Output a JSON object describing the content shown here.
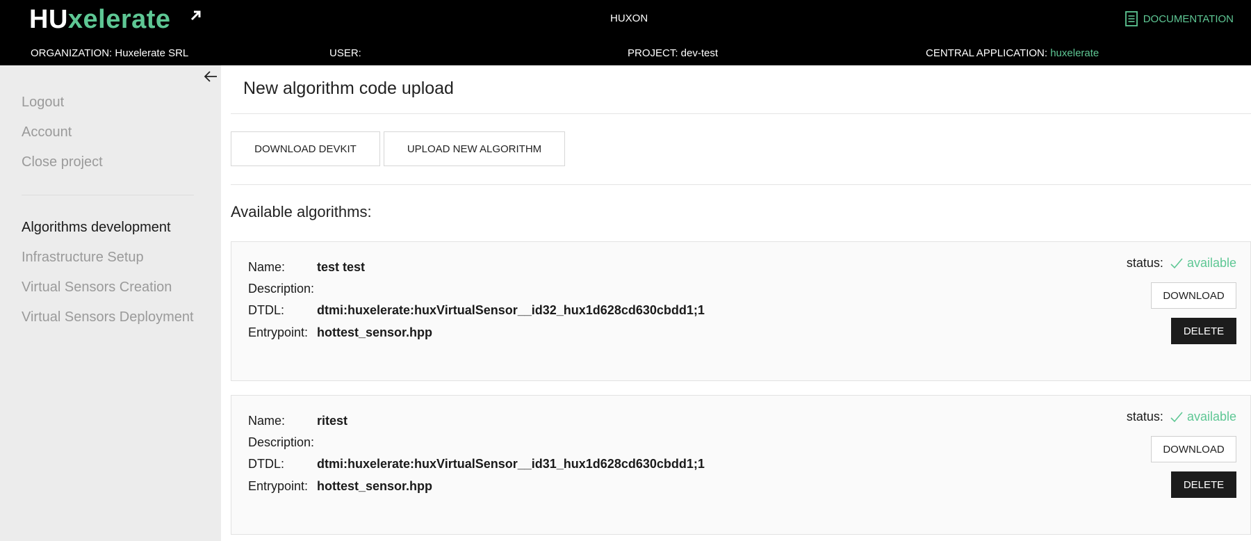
{
  "header": {
    "logo": {
      "part1": "HU",
      "part2": "xelerate"
    },
    "app_name": "HUXON",
    "documentation_label": "DOCUMENTATION",
    "organization": "ORGANIZATION: Huxelerate SRL",
    "user": "USER:",
    "project": "PROJECT: dev-test",
    "central_app_label": "CENTRAL APPLICATION:",
    "central_app_value": "huxelerate"
  },
  "sidebar": {
    "account_items": [
      "Logout",
      "Account",
      "Close project"
    ],
    "nav_items": [
      "Algorithms development",
      "Infrastructure Setup",
      "Virtual Sensors Creation",
      "Virtual Sensors Deployment"
    ],
    "active_item": "Algorithms development"
  },
  "main": {
    "title": "New algorithm code upload",
    "download_devkit_label": "DOWNLOAD DEVKIT",
    "upload_label": "UPLOAD NEW ALGORITHM",
    "available_title": "Available algorithms:",
    "labels": {
      "name": "Name:",
      "description": "Description:",
      "dtdl": "DTDL:",
      "entrypoint": "Entrypoint:",
      "status": "status:"
    },
    "download_label": "DOWNLOAD",
    "delete_label": "DELETE",
    "algorithms": [
      {
        "name": "test test",
        "description": "",
        "dtdl": "dtmi:huxelerate:huxVirtualSensor__id32_hux1d628cd630cbdd1;1",
        "entrypoint": "hottest_sensor.hpp",
        "status": "available"
      },
      {
        "name": "ritest",
        "description": "",
        "dtdl": "dtmi:huxelerate:huxVirtualSensor__id31_hux1d628cd630cbdd1;1",
        "entrypoint": "hottest_sensor.hpp",
        "status": "available"
      }
    ]
  },
  "colors": {
    "accent": "#5ec794",
    "header_bg": "#000000",
    "sidebar_bg": "#ececec",
    "delete_bg": "#1c1c1c"
  },
  "icons": {
    "documentation": "document-icon",
    "collapse": "arrow-left-icon",
    "status": "checkmark-icon",
    "logo_arrow": "arrow-up-right-icon"
  }
}
